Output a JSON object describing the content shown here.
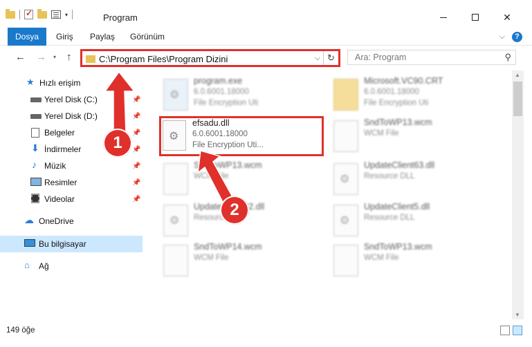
{
  "window": {
    "title": "Program",
    "minimize_icon": "minimize-icon",
    "maximize_icon": "maximize-icon",
    "close_glyph": "✕"
  },
  "ribbon": {
    "tabs": [
      "Dosya",
      "Giriş",
      "Paylaş",
      "Görünüm"
    ],
    "active_tab": "Dosya",
    "expand_glyph": "⌵",
    "help_glyph": "?"
  },
  "nav": {
    "back_glyph": "←",
    "forward_glyph": "→",
    "recent_glyph": "▾",
    "up_glyph": "↑",
    "address": "C:\\Program Files\\Program Dizini",
    "address_dropdown_glyph": "⌵",
    "refresh_glyph": "↻",
    "search_placeholder": "Ara: Program",
    "search_glyph": "⚲"
  },
  "sidebar": {
    "items": [
      {
        "label": "Hızlı erişim",
        "icon": "star-icon",
        "glyph": "★",
        "pinned": false
      },
      {
        "label": "Yerel Disk (C:)",
        "icon": "disk-icon",
        "glyph": "",
        "pinned": true
      },
      {
        "label": "Yerel Disk (D:)",
        "icon": "disk-icon",
        "glyph": "",
        "pinned": true
      },
      {
        "label": "Belgeler",
        "icon": "document-icon",
        "glyph": "",
        "pinned": true
      },
      {
        "label": "İndirmeler",
        "icon": "download-icon",
        "glyph": "⬇",
        "pinned": true
      },
      {
        "label": "Müzik",
        "icon": "music-icon",
        "glyph": "♪",
        "pinned": true
      },
      {
        "label": "Resimler",
        "icon": "pictures-icon",
        "glyph": "",
        "pinned": true
      },
      {
        "label": "Videolar",
        "icon": "video-icon",
        "glyph": "",
        "pinned": true
      },
      {
        "label": "OneDrive",
        "icon": "cloud-icon",
        "glyph": "☁",
        "pinned": false
      },
      {
        "label": "Bu bilgisayar",
        "icon": "computer-icon",
        "glyph": "",
        "pinned": false,
        "selected": true
      },
      {
        "label": "Ağ",
        "icon": "network-icon",
        "glyph": "⌂",
        "pinned": false
      }
    ],
    "pin_glyph": "📌"
  },
  "files": [
    {
      "name": "program.exe",
      "line2": "6.0.6001.18000",
      "line3": "File Encryption Uti",
      "blur": true
    },
    {
      "name": "Microsoft.VC90.CRT",
      "line2": "6.0.6001.18000",
      "line3": "File Encryption Uti",
      "blur": true
    },
    {
      "name": "efsadu.dll",
      "line2": "6.0.6001.18000",
      "line3": "File Encryption Uti...",
      "blur": false
    },
    {
      "name": "SndToWP13.wcm",
      "line2": "WCM File",
      "line3": "",
      "blur": true
    },
    {
      "name": "SndToWP13.wcm",
      "line2": "WCM File",
      "line3": "",
      "blur": true
    },
    {
      "name": "UpdateClient63.dll",
      "line2": "Resource DLL",
      "line3": "",
      "blur": true
    },
    {
      "name": "UpdateClient42.dll",
      "line2": "Resource DLL",
      "line3": "",
      "blur": true
    },
    {
      "name": "UpdateClient5.dll",
      "line2": "Resource DLL",
      "line3": "",
      "blur": true
    },
    {
      "name": "SndToWP14.wcm",
      "line2": "WCM File",
      "line3": "",
      "blur": true
    },
    {
      "name": "SndToWP13.wcm",
      "line2": "WCM File",
      "line3": "",
      "blur": true
    }
  ],
  "status": {
    "count": "149 öğe"
  },
  "annotations": {
    "badge1": "1",
    "badge2": "2"
  },
  "colors": {
    "accent": "#1979ca",
    "highlight": "#e0302b",
    "selection": "#cce8ff"
  }
}
